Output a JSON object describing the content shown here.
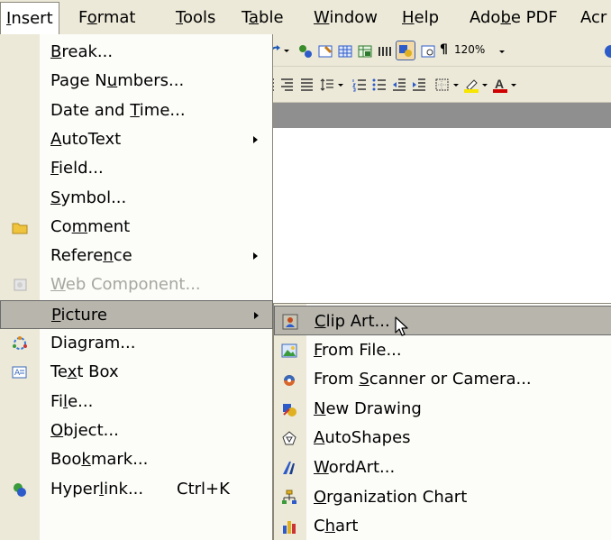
{
  "menubar": {
    "items": [
      {
        "pre": "",
        "acc": "I",
        "post": "nsert",
        "open": true
      },
      {
        "pre": "F",
        "acc": "o",
        "post": "rmat",
        "open": false
      },
      {
        "pre": "",
        "acc": "T",
        "post": "ools",
        "open": false
      },
      {
        "pre": "T",
        "acc": "a",
        "post": "ble",
        "open": false
      },
      {
        "pre": "",
        "acc": "W",
        "post": "indow",
        "open": false
      },
      {
        "pre": "",
        "acc": "H",
        "post": "elp",
        "open": false
      },
      {
        "pre": "Ado",
        "acc": "b",
        "post": "e PDF",
        "open": false
      },
      {
        "pre": "Acr",
        "acc": "",
        "post": "",
        "open": false
      }
    ]
  },
  "toolbar": {
    "zoom": "120%",
    "pilcrow": "¶"
  },
  "insert_menu": {
    "items": [
      {
        "pre": "",
        "acc": "B",
        "post": "reak...",
        "icon": "",
        "shortcut": "",
        "submenu": false,
        "disabled": false,
        "highlight": false
      },
      {
        "pre": "Page N",
        "acc": "u",
        "post": "mbers...",
        "icon": "",
        "shortcut": "",
        "submenu": false,
        "disabled": false,
        "highlight": false
      },
      {
        "pre": "Date and ",
        "acc": "T",
        "post": "ime...",
        "icon": "",
        "shortcut": "",
        "submenu": false,
        "disabled": false,
        "highlight": false
      },
      {
        "pre": "",
        "acc": "A",
        "post": "utoText",
        "icon": "",
        "shortcut": "",
        "submenu": true,
        "disabled": false,
        "highlight": false
      },
      {
        "pre": "",
        "acc": "F",
        "post": "ield...",
        "icon": "",
        "shortcut": "",
        "submenu": false,
        "disabled": false,
        "highlight": false
      },
      {
        "pre": "",
        "acc": "S",
        "post": "ymbol...",
        "icon": "",
        "shortcut": "",
        "submenu": false,
        "disabled": false,
        "highlight": false
      },
      {
        "pre": "Co",
        "acc": "m",
        "post": "ment",
        "icon": "comment-folder-icon",
        "shortcut": "",
        "submenu": false,
        "disabled": false,
        "highlight": false
      },
      {
        "pre": "Refere",
        "acc": "n",
        "post": "ce",
        "icon": "",
        "shortcut": "",
        "submenu": true,
        "disabled": false,
        "highlight": false
      },
      {
        "pre": "",
        "acc": "W",
        "post": "eb Component...",
        "icon": "web-component-icon",
        "shortcut": "",
        "submenu": false,
        "disabled": true,
        "highlight": false
      },
      {
        "pre": "",
        "acc": "P",
        "post": "icture",
        "icon": "",
        "shortcut": "",
        "submenu": true,
        "disabled": false,
        "highlight": true
      },
      {
        "pre": "Dia",
        "acc": "g",
        "post": "ram...",
        "icon": "diagram-icon",
        "shortcut": "",
        "submenu": false,
        "disabled": false,
        "highlight": false
      },
      {
        "pre": "Te",
        "acc": "x",
        "post": "t Box",
        "icon": "text-box-icon",
        "shortcut": "",
        "submenu": false,
        "disabled": false,
        "highlight": false
      },
      {
        "pre": "Fi",
        "acc": "l",
        "post": "e...",
        "icon": "",
        "shortcut": "",
        "submenu": false,
        "disabled": false,
        "highlight": false
      },
      {
        "pre": "",
        "acc": "O",
        "post": "bject...",
        "icon": "",
        "shortcut": "",
        "submenu": false,
        "disabled": false,
        "highlight": false
      },
      {
        "pre": "Boo",
        "acc": "k",
        "post": "mark...",
        "icon": "",
        "shortcut": "",
        "submenu": false,
        "disabled": false,
        "highlight": false
      },
      {
        "pre": "Hyper",
        "acc": "l",
        "post": "ink...",
        "icon": "hyperlink-icon",
        "shortcut": "Ctrl+K",
        "submenu": false,
        "disabled": false,
        "highlight": false
      }
    ]
  },
  "picture_submenu": {
    "items": [
      {
        "pre": "",
        "acc": "C",
        "post": "lip Art...",
        "icon": "clip-art-icon",
        "highlight": true
      },
      {
        "pre": "",
        "acc": "F",
        "post": "rom File...",
        "icon": "from-file-icon",
        "highlight": false
      },
      {
        "pre": "From ",
        "acc": "S",
        "post": "canner or Camera...",
        "icon": "scanner-camera-icon",
        "highlight": false
      },
      {
        "pre": "",
        "acc": "N",
        "post": "ew Drawing",
        "icon": "new-drawing-icon",
        "highlight": false
      },
      {
        "pre": "",
        "acc": "A",
        "post": "utoShapes",
        "icon": "autoshapes-icon",
        "highlight": false
      },
      {
        "pre": "",
        "acc": "W",
        "post": "ordArt...",
        "icon": "wordart-icon",
        "highlight": false
      },
      {
        "pre": "",
        "acc": "O",
        "post": "rganization Chart",
        "icon": "organization-chart-icon",
        "highlight": false
      },
      {
        "pre": "C",
        "acc": "h",
        "post": "art",
        "icon": "chart-icon",
        "highlight": false
      }
    ]
  },
  "colors": {
    "menubar_bg": "#ece9d8",
    "menu_bg": "#fcfcf9",
    "highlight_bg": "#b7b5ac",
    "disabled_text": "#a7a7a0"
  }
}
